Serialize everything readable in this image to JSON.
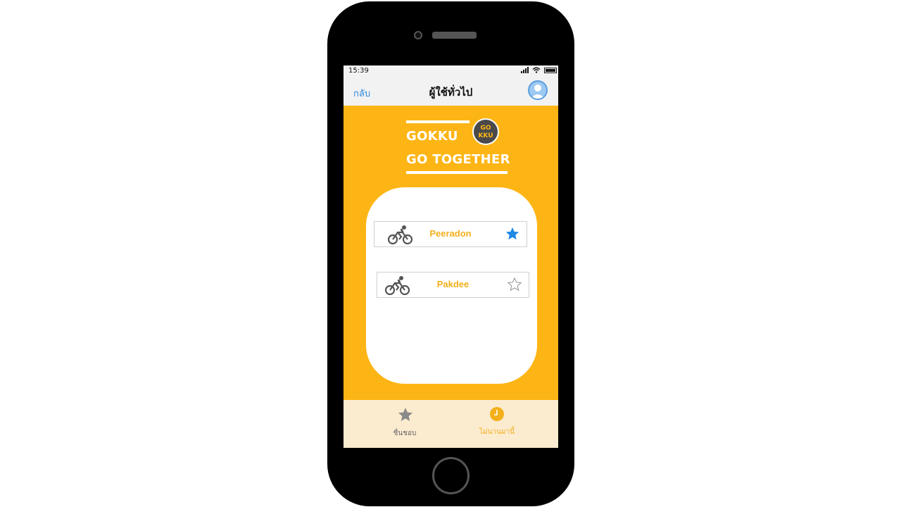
{
  "status_bar": {
    "time": "15:39"
  },
  "nav": {
    "back_label": "กลับ",
    "title": "ผู้ใช้ทั่วไป"
  },
  "logo": {
    "line1": "GOKKU",
    "line2": "GO TOGETHER",
    "badge_top": "GO",
    "badge_bottom": "KKU"
  },
  "list": {
    "items": [
      {
        "name": "Peeradon",
        "icon": "bicycle-icon",
        "favorite": true
      },
      {
        "name": "Pakdee",
        "icon": "bicycle-icon",
        "favorite": false
      }
    ]
  },
  "tabs": [
    {
      "label": "ชื่นชอบ",
      "icon": "star-icon",
      "active": false
    },
    {
      "label": "ไม่นานมานี้",
      "icon": "clock-icon",
      "active": true
    }
  ],
  "colors": {
    "brand_yellow": "#FDB515",
    "favorite_blue": "#1E88E5",
    "tab_bar_bg": "#FBEBCF",
    "link_blue": "#2D88D8"
  }
}
